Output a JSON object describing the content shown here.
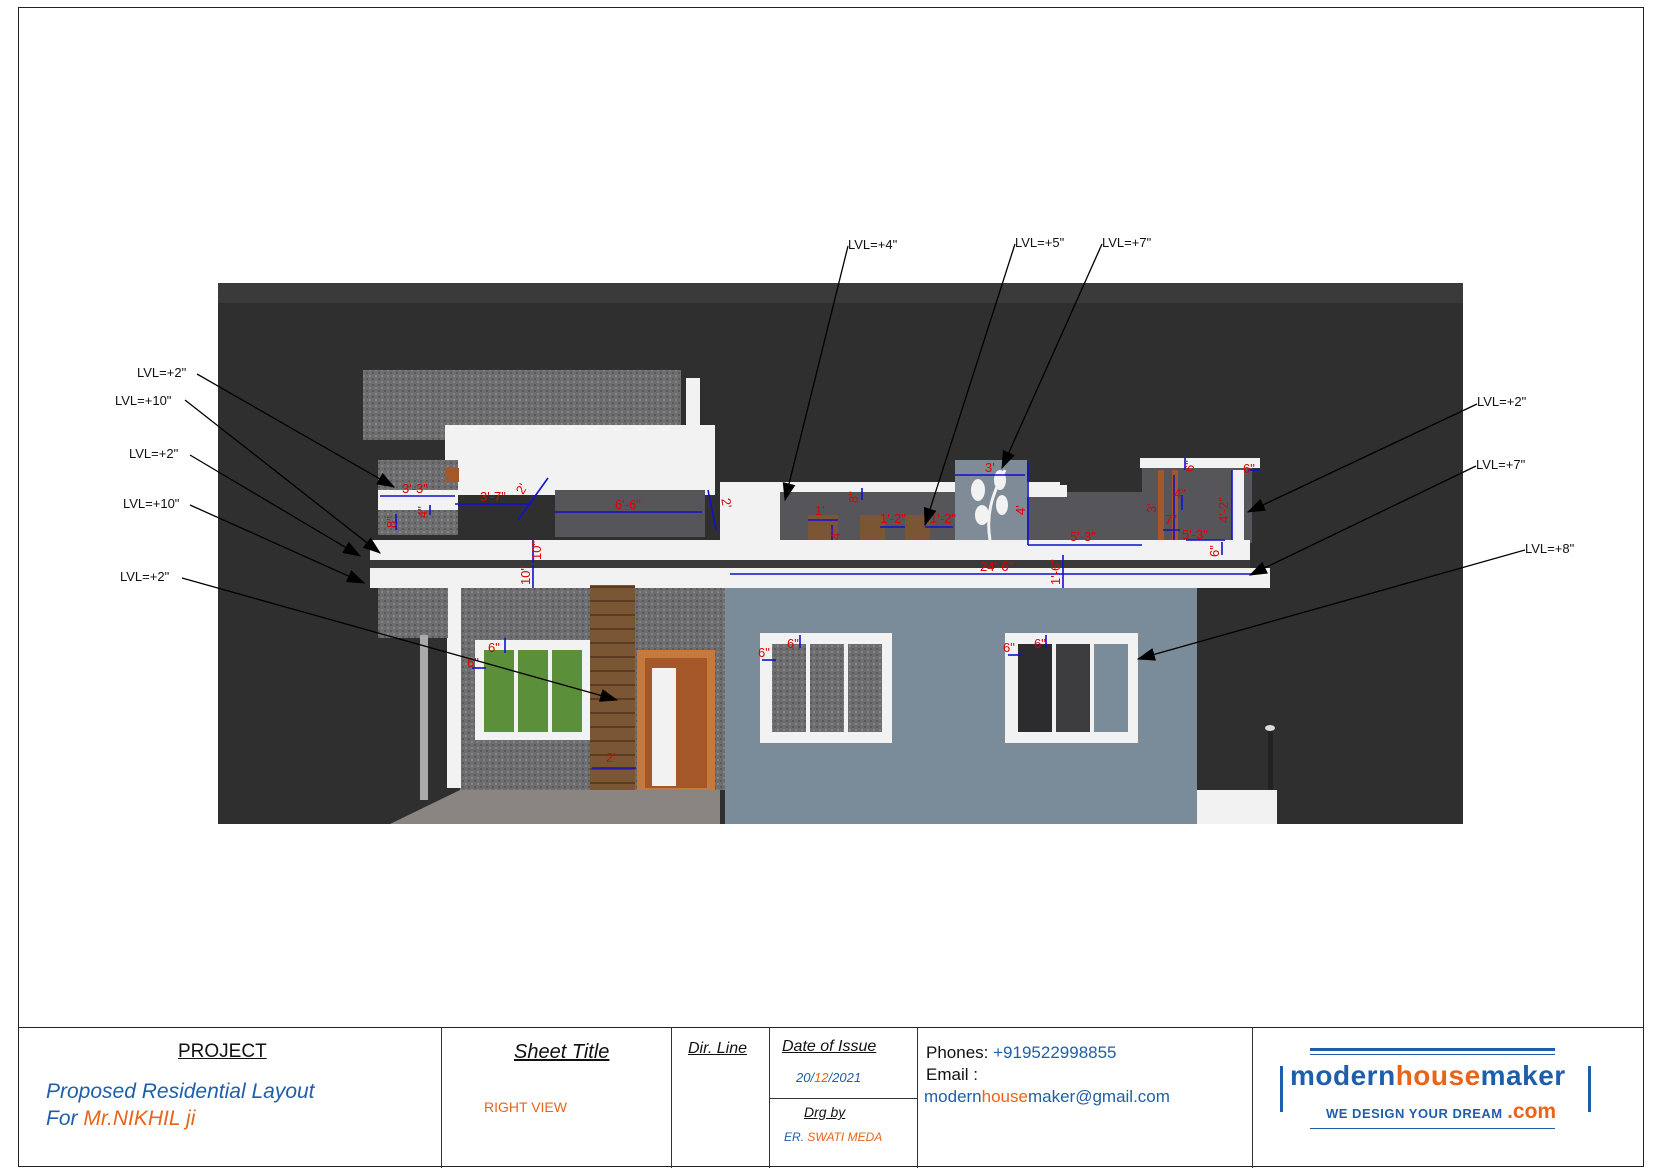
{
  "levels": {
    "left": [
      "LVL=+2\"",
      "LVL=+10\"",
      "LVL=+2\"",
      "LVL=+10\"",
      "LVL=+2\""
    ],
    "top": [
      "LVL=+4\"",
      "LVL=+5\"",
      "LVL=+7\""
    ],
    "right": [
      "LVL=+2\"",
      "LVL=+7\"",
      "LVL=+8\""
    ]
  },
  "dimensions": {
    "d_3_3": "3'-3\"",
    "d_3_7": "3'-7\"",
    "d_2a": "2'",
    "d_6_6": "6'-6\"",
    "d_2b": "2'",
    "d_8a": "8\"",
    "d_4a": "4\"",
    "d_10a": "10\"",
    "d_10b": "10\"",
    "d_1": "1'",
    "d_4b": "4\"",
    "d_8b": "8\"",
    "d_1_2a": "1'-2\"",
    "d_1_2b": "1'-2\"",
    "d_3a": "3'",
    "d_4c": "4'",
    "d_5_3a": "5'-3\"",
    "d_24_6": "24'-6\"",
    "d_1_6": "1'-6\"",
    "d_6a": "6\"",
    "d_3b": "3'",
    "d_4d": "4\"",
    "d_7": "7\"",
    "d_5_3b": "5'-3\"",
    "d_6b": "6\"",
    "d_4_2": "4'-2\"",
    "d_6c": "6\"",
    "d_6d": "6\"",
    "d_6e": "6\"",
    "d_6f": "6\"",
    "d_6g": "6\"",
    "d_6h": "6\"",
    "d_6i": "6\"",
    "d_2c": "2'"
  },
  "titleblock": {
    "project_heading": "PROJECT",
    "project_line1": "Proposed Residential Layout",
    "project_for": "For ",
    "project_client": "Mr.NIKHIL  ji",
    "sheet_title_heading": "Sheet Title",
    "sheet_title_value": "RIGHT  VIEW",
    "dir_line_heading": "Dir. Line",
    "date_heading": "Date of Issue",
    "date_day": "20/",
    "date_month": "12",
    "date_year": "/2021",
    "drg_by_heading": "Drg by",
    "drg_by_prefix": "ER. ",
    "drg_by_name": "SWATI MEDA",
    "phones_label": "Phones:",
    "phones_value": "+919522998855",
    "email_label": "Email :",
    "email_part1": "modern",
    "email_part2": "house",
    "email_part3": "maker@gmail.com",
    "logo_modern": "modern",
    "logo_house": "house",
    "logo_maker": "maker",
    "logo_tagline": "WE DESIGN YOUR DREAM",
    "logo_com": ".com"
  },
  "colors": {
    "background_dark": "#2e2e2e",
    "wall_blue_grey": "#7a8b99",
    "stone_grey": "#6d6d70",
    "slab_white": "#f2f2f2",
    "window_green": "#5c8f3a",
    "door_brown": "#a4582a",
    "dimension_red": "#e00000",
    "dimension_line_blue": "#1010d0",
    "brand_blue": "#1f5ea8",
    "brand_orange": "#e8641b"
  }
}
